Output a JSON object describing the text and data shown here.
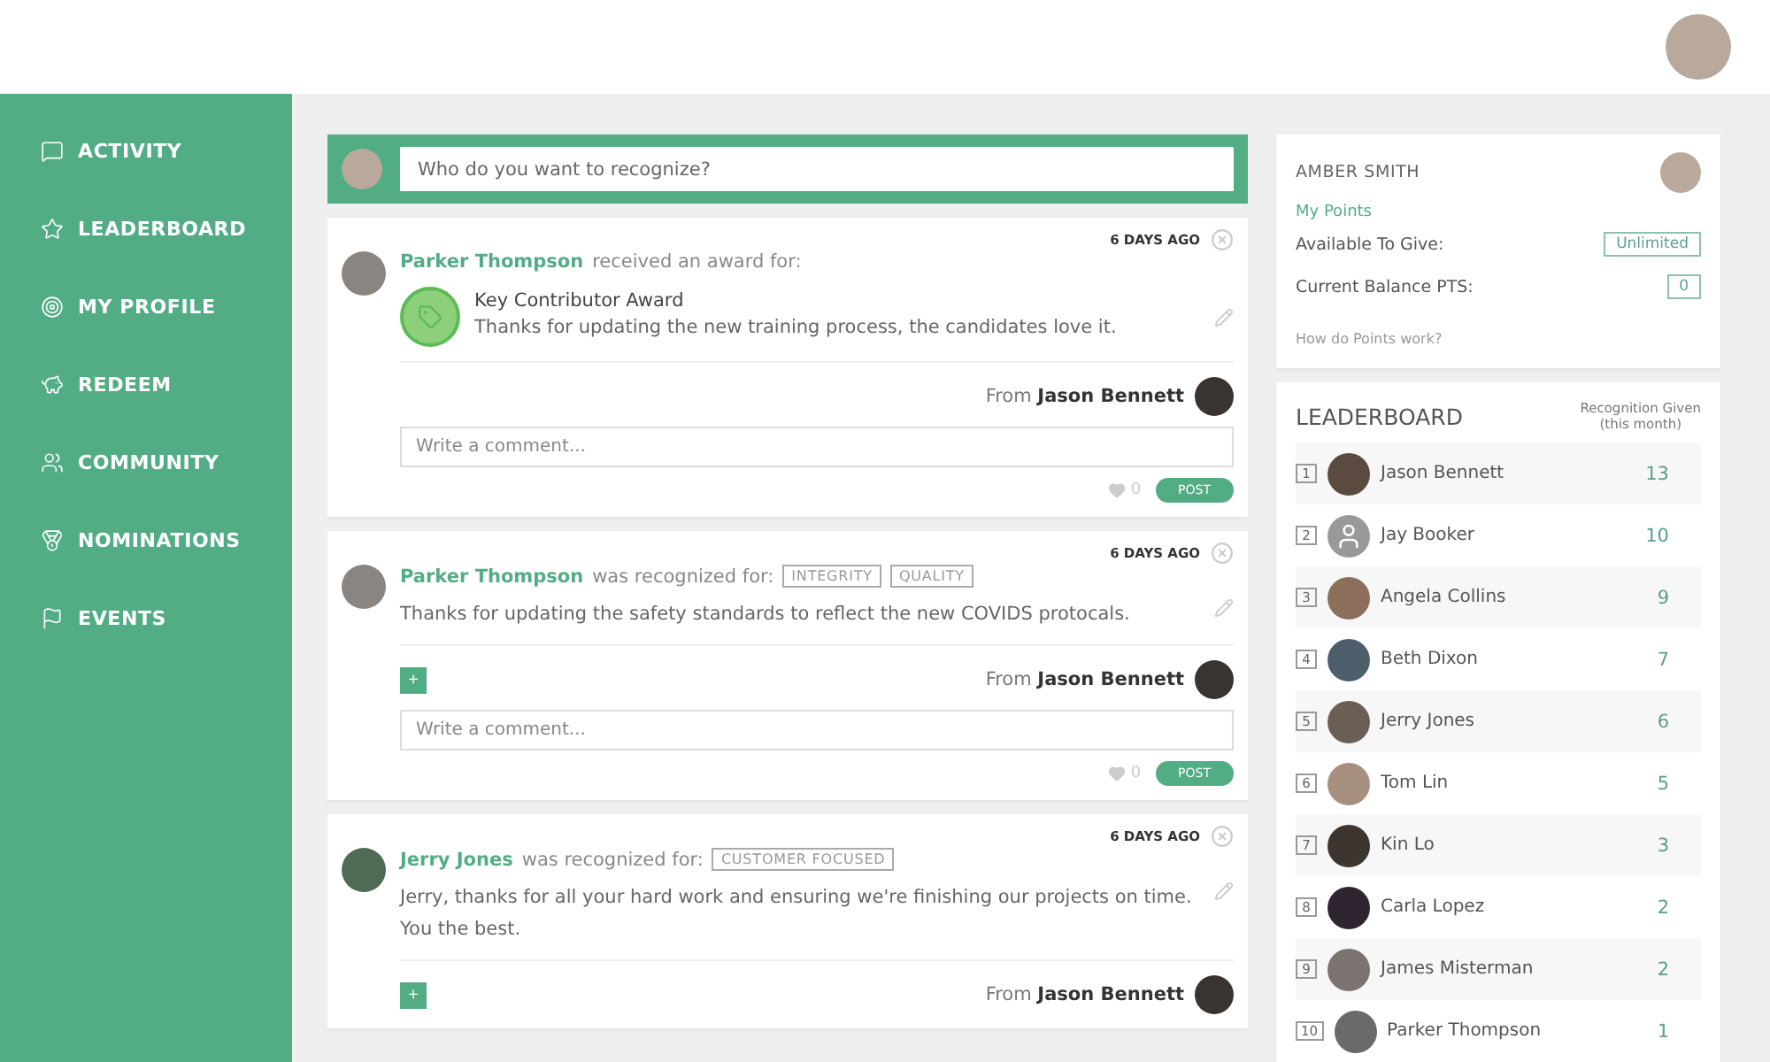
{
  "sidebar": {
    "items": [
      {
        "label": "ACTIVITY"
      },
      {
        "label": "LEADERBOARD"
      },
      {
        "label": "MY PROFILE"
      },
      {
        "label": "REDEEM"
      },
      {
        "label": "COMMUNITY"
      },
      {
        "label": "NOMINATIONS"
      },
      {
        "label": "EVENTS"
      }
    ]
  },
  "composer": {
    "placeholder": "Who do you want to recognize?"
  },
  "posts": [
    {
      "kind": "award",
      "time": "6 DAYS AGO",
      "name": "Parker Thompson",
      "action": "received an award for:",
      "award": "Key Contributor Award",
      "message": "Thanks for updating the new training process, the candidates love it.",
      "from_label": "From",
      "from": "Jason Bennett",
      "add_button": false,
      "comment_placeholder": "Write a comment...",
      "likes": "0",
      "post_label": "POST"
    },
    {
      "kind": "values",
      "time": "6 DAYS AGO",
      "name": "Parker Thompson",
      "action": "was recognized for:",
      "tags": [
        "INTEGRITY",
        "QUALITY"
      ],
      "message": "Thanks for updating the safety standards to reflect the new COVIDS protocals.",
      "from_label": "From",
      "from": "Jason Bennett",
      "add_button": true,
      "add_label": "+",
      "comment_placeholder": "Write a comment...",
      "likes": "0",
      "post_label": "POST"
    },
    {
      "kind": "values",
      "time": "6 DAYS AGO",
      "name": "Jerry Jones",
      "action": "was recognized for:",
      "tags": [
        "CUSTOMER FOCUSED"
      ],
      "message": "Jerry, thanks for all your hard work and ensuring we're finishing our projects on time. You the best.",
      "from_label": "From",
      "from": "Jason Bennett",
      "add_button": true,
      "add_label": "+"
    }
  ],
  "profile": {
    "name": "AMBER SMITH",
    "points_title": "My Points",
    "rows": [
      {
        "label": "Available To Give:",
        "value": "Unlimited"
      },
      {
        "label": "Current Balance PTS:",
        "value": "0"
      }
    ],
    "help_link": "How do Points work?"
  },
  "leaderboard": {
    "title": "LEADERBOARD",
    "column_heading": "Recognition Given",
    "column_subheading": "(this month)",
    "rows": [
      {
        "rank": "1",
        "name": "Jason Bennett",
        "count": "13",
        "kind": "photo"
      },
      {
        "rank": "2",
        "name": "Jay Booker",
        "count": "10",
        "kind": "generic"
      },
      {
        "rank": "3",
        "name": "Angela Collins",
        "count": "9",
        "kind": "photo"
      },
      {
        "rank": "4",
        "name": "Beth Dixon",
        "count": "7",
        "kind": "photo"
      },
      {
        "rank": "5",
        "name": "Jerry Jones",
        "count": "6",
        "kind": "photo"
      },
      {
        "rank": "6",
        "name": "Tom Lin",
        "count": "5",
        "kind": "photo"
      },
      {
        "rank": "7",
        "name": "Kin Lo",
        "count": "3",
        "kind": "photo"
      },
      {
        "rank": "8",
        "name": "Carla Lopez",
        "count": "2",
        "kind": "photo"
      },
      {
        "rank": "9",
        "name": "James Misterman",
        "count": "2",
        "kind": "photo"
      },
      {
        "rank": "10",
        "name": "Parker Thompson",
        "count": "1",
        "kind": "photo"
      }
    ]
  }
}
